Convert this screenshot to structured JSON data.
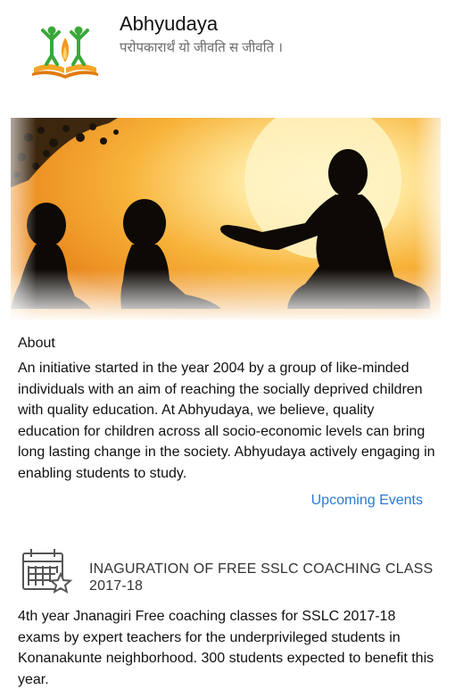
{
  "header": {
    "title": "Abhyudaya",
    "tagline": "परोपकारार्थं यो जीवति स जीवति ।",
    "logo_icon": "abhyudaya-logo-icon"
  },
  "hero": {
    "image_icon": "teacher-students-silhouette-image"
  },
  "about": {
    "heading": "About",
    "body": "An initiative started in the year 2004 by a group of like-minded individuals with an aim of reaching the socially deprived children with quality education. At Abhyudaya, we believe, quality education for children across all socio-economic levels can bring long lasting change in the society. Abhyudaya actively engaging in enabling students to study."
  },
  "upcoming_events_link": "Upcoming Events",
  "event": {
    "icon": "calendar-star-icon",
    "title": "INAGURATION OF FREE SSLC COACHING CLASS 2017-18",
    "body": "4th year Jnanagiri Free coaching classes for SSLC 2017-18 exams by expert teachers for the underprivileged students in Konanakunte neighborhood. 300 students expected to benefit this year."
  },
  "colors": {
    "link": "#2a7ad6",
    "tagline": "#6b6b6b",
    "logo_orange": "#f39a1f",
    "logo_green": "#3aa83a"
  }
}
